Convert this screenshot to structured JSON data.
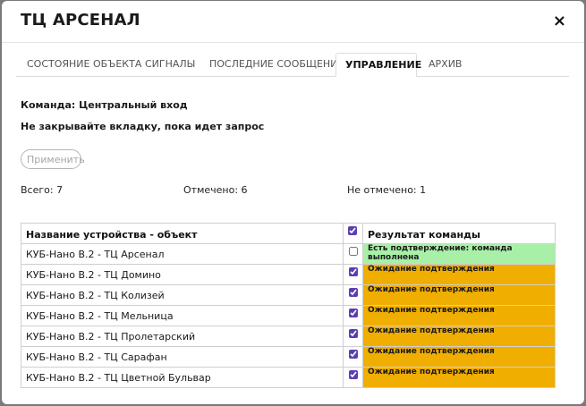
{
  "modal": {
    "title": "ТЦ АРСЕНАЛ",
    "close": "×"
  },
  "tabs": [
    {
      "label": "СОСТОЯНИЕ ОБЪЕКТА",
      "active": false
    },
    {
      "label": "СИГНАЛЫ",
      "active": false
    },
    {
      "label": "ПОСЛЕДНИЕ СООБЩЕНИЯ",
      "active": false
    },
    {
      "label": "УПРАВЛЕНИЕ",
      "active": true
    },
    {
      "label": "АРХИВ",
      "active": false
    }
  ],
  "control": {
    "command": "Команда: Центральный вход",
    "warning": "Не закрывайте вкладку, пока идет запрос",
    "apply_label": "Применить"
  },
  "stats": {
    "total": "Всего: 7",
    "checked": "Отмечено: 6",
    "unchecked": "Не отмечено: 1"
  },
  "table": {
    "headers": {
      "name": "Название устройства - объект",
      "result": "Результат команды",
      "select_all_checked": true
    },
    "rows": [
      {
        "name": "КУБ-Нано В.2 - ТЦ Арсенал",
        "checked": false,
        "result": "Есть подтверждение: команда выполнена",
        "status": "ok"
      },
      {
        "name": "КУБ-Нано В.2 - ТЦ Домино",
        "checked": true,
        "result": "Ожидание подтверждения",
        "status": "wait"
      },
      {
        "name": "КУБ-Нано В.2 - ТЦ Колизей",
        "checked": true,
        "result": "Ожидание подтверждения",
        "status": "wait"
      },
      {
        "name": "КУБ-Нано В.2 - ТЦ Мельница",
        "checked": true,
        "result": "Ожидание подтверждения",
        "status": "wait"
      },
      {
        "name": "КУБ-Нано В.2 - ТЦ Пролетарский",
        "checked": true,
        "result": "Ожидание подтверждения",
        "status": "wait"
      },
      {
        "name": "КУБ-Нано В.2 - ТЦ Сарафан",
        "checked": true,
        "result": "Ожидание подтверждения",
        "status": "wait"
      },
      {
        "name": "КУБ-Нано В.2 - ТЦ Цветной Бульвар",
        "checked": true,
        "result": "Ожидание подтверждения",
        "status": "wait"
      }
    ]
  },
  "colors": {
    "ok": "#a8f0a8",
    "wait": "#f0ae00",
    "checkbox_accent": "#5b3fb0"
  }
}
